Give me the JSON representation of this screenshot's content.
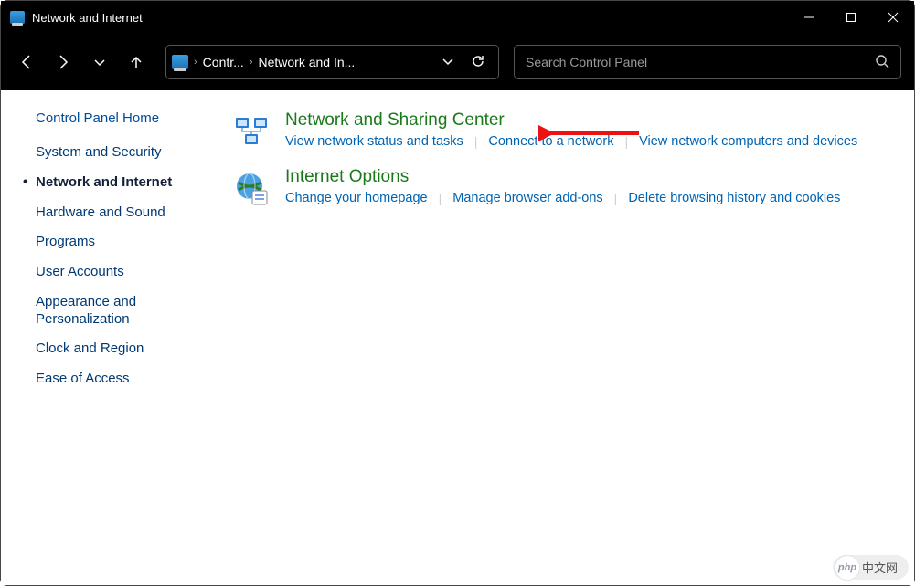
{
  "window": {
    "title": "Network and Internet"
  },
  "toolbar": {
    "breadcrumb": [
      "Contr...",
      "Network and In..."
    ],
    "search_placeholder": "Search Control Panel"
  },
  "sidebar": {
    "home_label": "Control Panel Home",
    "items": [
      {
        "label": "System and Security",
        "active": false
      },
      {
        "label": "Network and Internet",
        "active": true
      },
      {
        "label": "Hardware and Sound",
        "active": false
      },
      {
        "label": "Programs",
        "active": false
      },
      {
        "label": "User Accounts",
        "active": false
      },
      {
        "label": "Appearance and Personalization",
        "active": false
      },
      {
        "label": "Clock and Region",
        "active": false
      },
      {
        "label": "Ease of Access",
        "active": false
      }
    ]
  },
  "categories": [
    {
      "title": "Network and Sharing Center",
      "sublinks": [
        "View network status and tasks",
        "Connect to a network",
        "View network computers and devices"
      ]
    },
    {
      "title": "Internet Options",
      "sublinks": [
        "Change your homepage",
        "Manage browser add-ons",
        "Delete browsing history and cookies"
      ]
    }
  ],
  "watermark": {
    "badge": "php",
    "text": "中文网"
  }
}
